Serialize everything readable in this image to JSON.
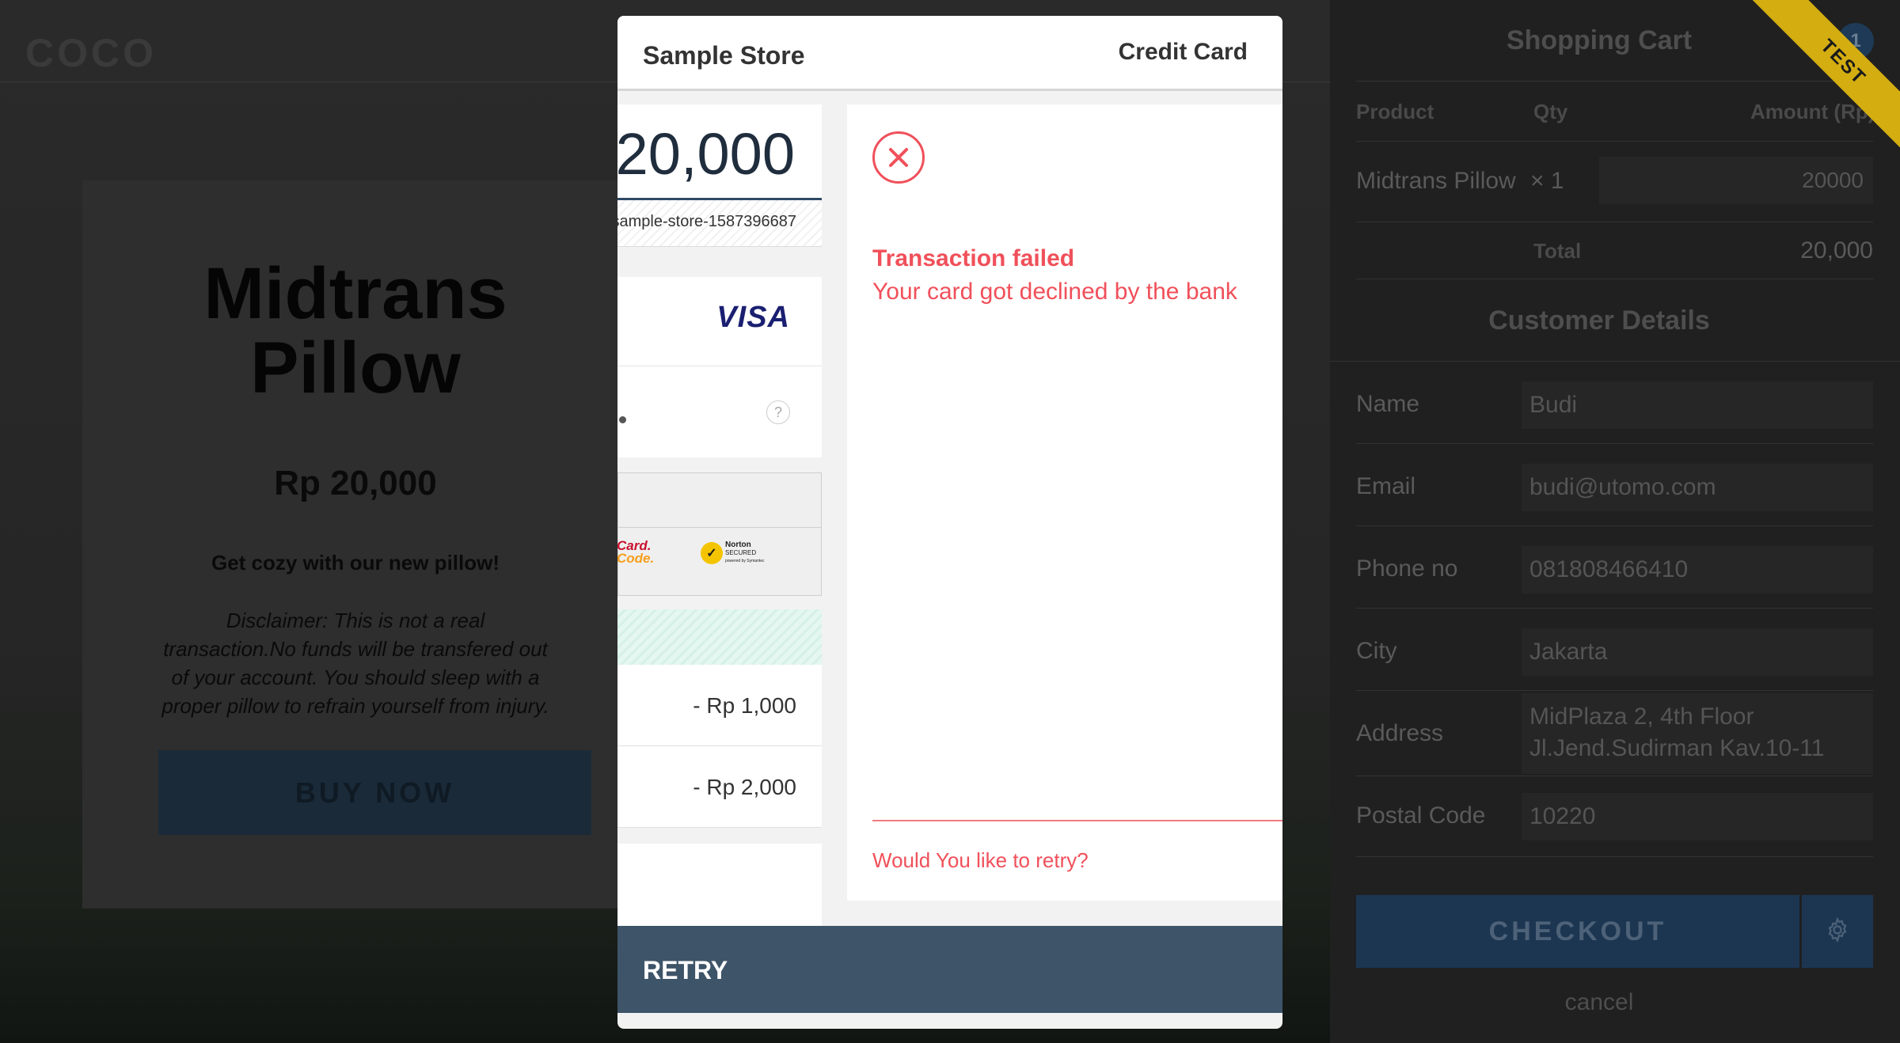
{
  "background": {
    "logo": "COCO",
    "product": {
      "title_line1": "Midtrans",
      "title_line2": "Pillow",
      "price": "Rp 20,000",
      "tagline": "Get cozy with our new pillow!",
      "disclaimer": "Disclaimer: This is not a real transaction.No funds will be transfered out of your account. You should sleep with a proper pillow to refrain yourself from injury.",
      "buy_button": "BUY NOW"
    }
  },
  "cart": {
    "title": "Shopping Cart",
    "badge_count": "1",
    "ribbon": "TEST",
    "headers": {
      "product": "Product",
      "qty": "Qty",
      "amount": "Amount (Rp)"
    },
    "item": {
      "name": "Midtrans Pillow",
      "qty": "× 1",
      "amount": "20000"
    },
    "total_label": "Total",
    "total_value": "20,000",
    "customer_details_title": "Customer Details",
    "fields": {
      "name": {
        "label": "Name",
        "value": "Budi"
      },
      "email": {
        "label": "Email",
        "value": "budi@utomo.com"
      },
      "phone": {
        "label": "Phone no",
        "value": "081808466410"
      },
      "city": {
        "label": "City",
        "value": "Jakarta"
      },
      "address": {
        "label": "Address",
        "value_line1": "MidPlaza 2, 4th Floor",
        "value_line2": "Jl.Jend.Sudirman Kav.10-11"
      },
      "postal": {
        "label": "Postal Code",
        "value": "10220"
      }
    },
    "checkout_button": "CHECKOUT",
    "cancel_link": "cancel"
  },
  "modal": {
    "store_name": "Sample Store",
    "payment_type": "Credit Card",
    "amount": "20,000",
    "order_id": "sample-store-1587396687",
    "card_brand": "VISA",
    "cvv_help": "?",
    "securecode_line1": "Card.",
    "securecode_line2": "Code.",
    "norton_line1": "Norton",
    "norton_line2": "SECURED",
    "norton_line3": "powered by Symantec",
    "promos": [
      "- Rp 1,000",
      "- Rp 2,000"
    ],
    "result": {
      "title": "Transaction failed",
      "message": "Your card got declined by the bank",
      "retry_question": "Would You like to retry?"
    },
    "retry_button": "RETRY"
  },
  "colors": {
    "error": "#f0505a",
    "retry_bar": "#3e5468",
    "checkout": "#1c3652",
    "ribbon": "#d4ad11"
  }
}
